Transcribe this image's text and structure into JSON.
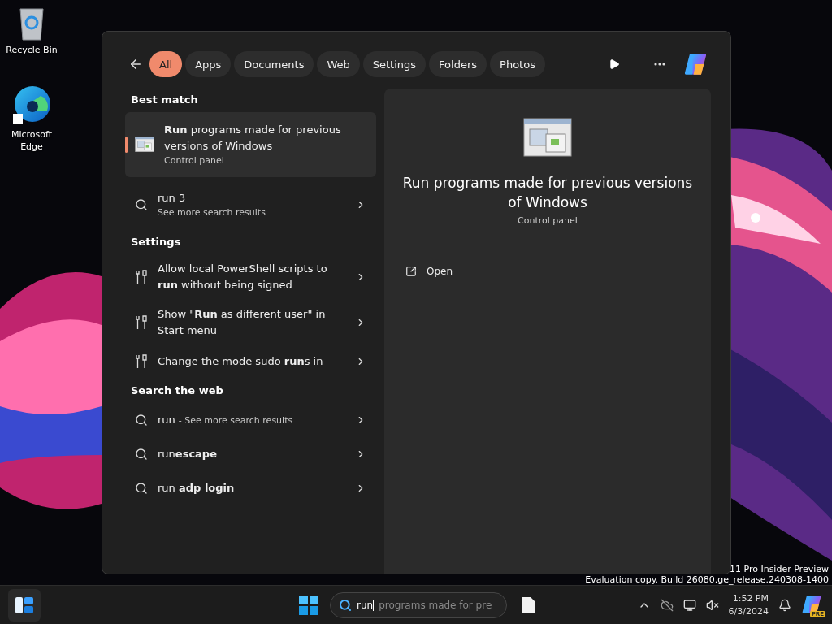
{
  "desktop_icons": [
    {
      "kind": "recycle",
      "label": "Recycle Bin"
    },
    {
      "kind": "edge",
      "label": "Microsoft Edge"
    }
  ],
  "watermark": [
    "11 Pro Insider Preview",
    "Evaluation copy. Build 26080.ge_release.240308-1400"
  ],
  "search_panel": {
    "filters": [
      {
        "label": "All",
        "selected": true
      },
      {
        "label": "Apps",
        "selected": false
      },
      {
        "label": "Documents",
        "selected": false
      },
      {
        "label": "Web",
        "selected": false
      },
      {
        "label": "Settings",
        "selected": false
      },
      {
        "label": "Folders",
        "selected": false
      },
      {
        "label": "Photos",
        "selected": false
      }
    ],
    "best_match": {
      "heading": "Best match",
      "title": "**Run** programs made for previous versions of Windows",
      "subtitle": "Control panel",
      "selected": true
    },
    "more_results": {
      "title": "run 3",
      "subtitle": "See more search results"
    },
    "settings": {
      "heading": "Settings",
      "items": [
        {
          "title": "Allow local PowerShell scripts to **run** without being signed"
        },
        {
          "title": "Show \"**Run** as different user\" in Start menu"
        },
        {
          "title": "Change the mode sudo **run**s in"
        }
      ]
    },
    "web": {
      "heading": "Search the web",
      "items": [
        {
          "title": "run",
          "note": "- See more search results"
        },
        {
          "title": "run**escape**"
        },
        {
          "title": "run **adp login**"
        }
      ]
    },
    "preview": {
      "title": "Run programs made for previous versions of Windows",
      "subtitle": "Control panel",
      "actions": [
        "Open"
      ]
    }
  },
  "taskbar": {
    "search": {
      "value": "run",
      "suggestion": "programs made for pre"
    },
    "time": "1:52 PM",
    "date": "6/3/2024",
    "copilot_badge": "PRE"
  }
}
